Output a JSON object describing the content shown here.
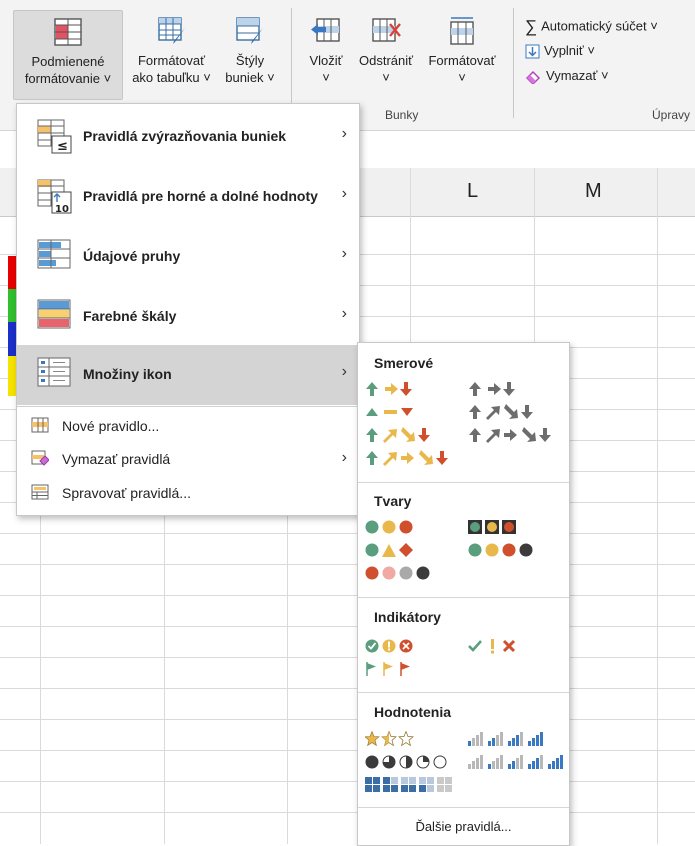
{
  "ribbon": {
    "conditional_formatting": {
      "line1": "Podmienené",
      "line2": "formátovanie ˅"
    },
    "format_as_table": {
      "line1": "Formátovať",
      "line2": "ako tabuľku ˅"
    },
    "cell_styles": {
      "line1": "Štýly",
      "line2": "buniek ˅"
    },
    "insert": {
      "line1": "Vložiť",
      "line2": "˅"
    },
    "delete": {
      "line1": "Odstrániť",
      "line2": "˅"
    },
    "format": {
      "line1": "Formátovať",
      "line2": "˅"
    },
    "cells_group_label": "Bunky",
    "autosum": "Automatický súčet ˅",
    "fill": "Vyplniť ˅",
    "clear": "Vymazať ˅",
    "editing_group_label": "Úpravy"
  },
  "grid": {
    "columns": [
      "L",
      "M"
    ]
  },
  "menu": {
    "highlight_rules": "Pravidlá zvýrazňovania buniek",
    "top_bottom": "Pravidlá pre horné a dolné hodnoty",
    "data_bars": "Údajové pruhy",
    "color_scales": "Farebné škály",
    "icon_sets": "Množiny ikon",
    "new_rule": "Nové pravidlo...",
    "clear_rules": "Vymazať pravidlá",
    "manage_rules": "Spravovať pravidlá..."
  },
  "submenu": {
    "directional": "Smerové",
    "shapes": "Tvary",
    "indicators": "Indikátory",
    "ratings": "Hodnotenia",
    "more_rules": "Ďalšie pravidlá..."
  },
  "colors": {
    "green": "#5a9e7e",
    "yellow": "#e8b84b",
    "red": "#d0502e",
    "gray": "#6d6d6d",
    "blue": "#3a6ea5",
    "selected_bg": "#d4d4d4"
  }
}
